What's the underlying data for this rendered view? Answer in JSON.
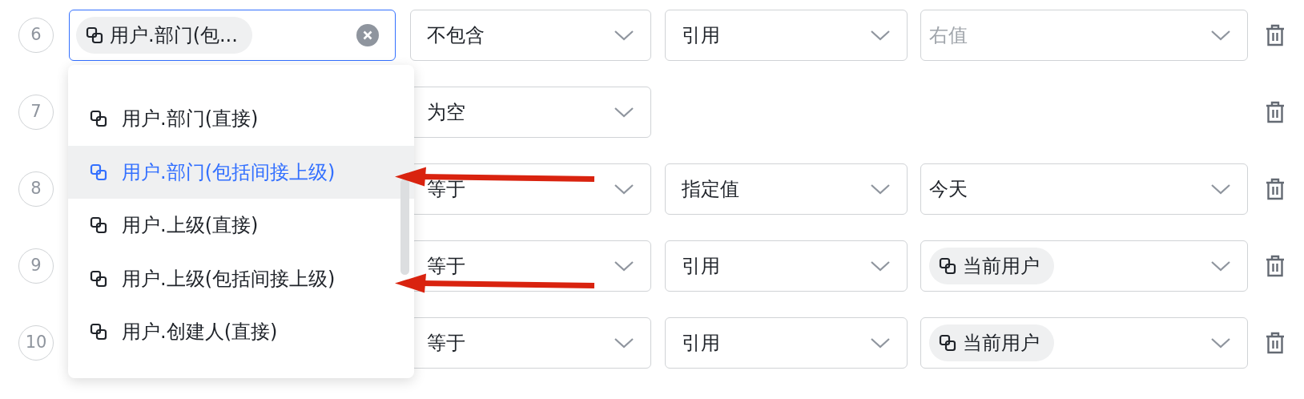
{
  "rows": [
    {
      "index": "6",
      "field": {
        "kind": "tag",
        "text": "用户.部门(包...",
        "focused": true,
        "clearable": true
      },
      "operator": "不包含",
      "value_type": "引用",
      "value": {
        "kind": "placeholder",
        "text": "右值"
      }
    },
    {
      "index": "7",
      "operator": "为空"
    },
    {
      "index": "8",
      "operator": "等于",
      "value_type": "指定值",
      "value": {
        "kind": "text",
        "text": "今天"
      }
    },
    {
      "index": "9",
      "operator": "等于",
      "value_type": "引用",
      "value": {
        "kind": "tag",
        "text": "当前用户"
      }
    },
    {
      "index": "10",
      "operator": "等于",
      "value_type": "引用",
      "value": {
        "kind": "tag",
        "text": "当前用户"
      }
    }
  ],
  "dropdown": {
    "items": [
      {
        "label": "用户.部门(直接)",
        "selected": false
      },
      {
        "label": "用户.部门(包括间接上级)",
        "selected": true,
        "arrow": true
      },
      {
        "label": "用户.上级(直接)",
        "selected": false
      },
      {
        "label": "用户.上级(包括间接上级)",
        "selected": false,
        "arrow": true
      },
      {
        "label": "用户.创建人(直接)",
        "selected": false
      }
    ]
  }
}
